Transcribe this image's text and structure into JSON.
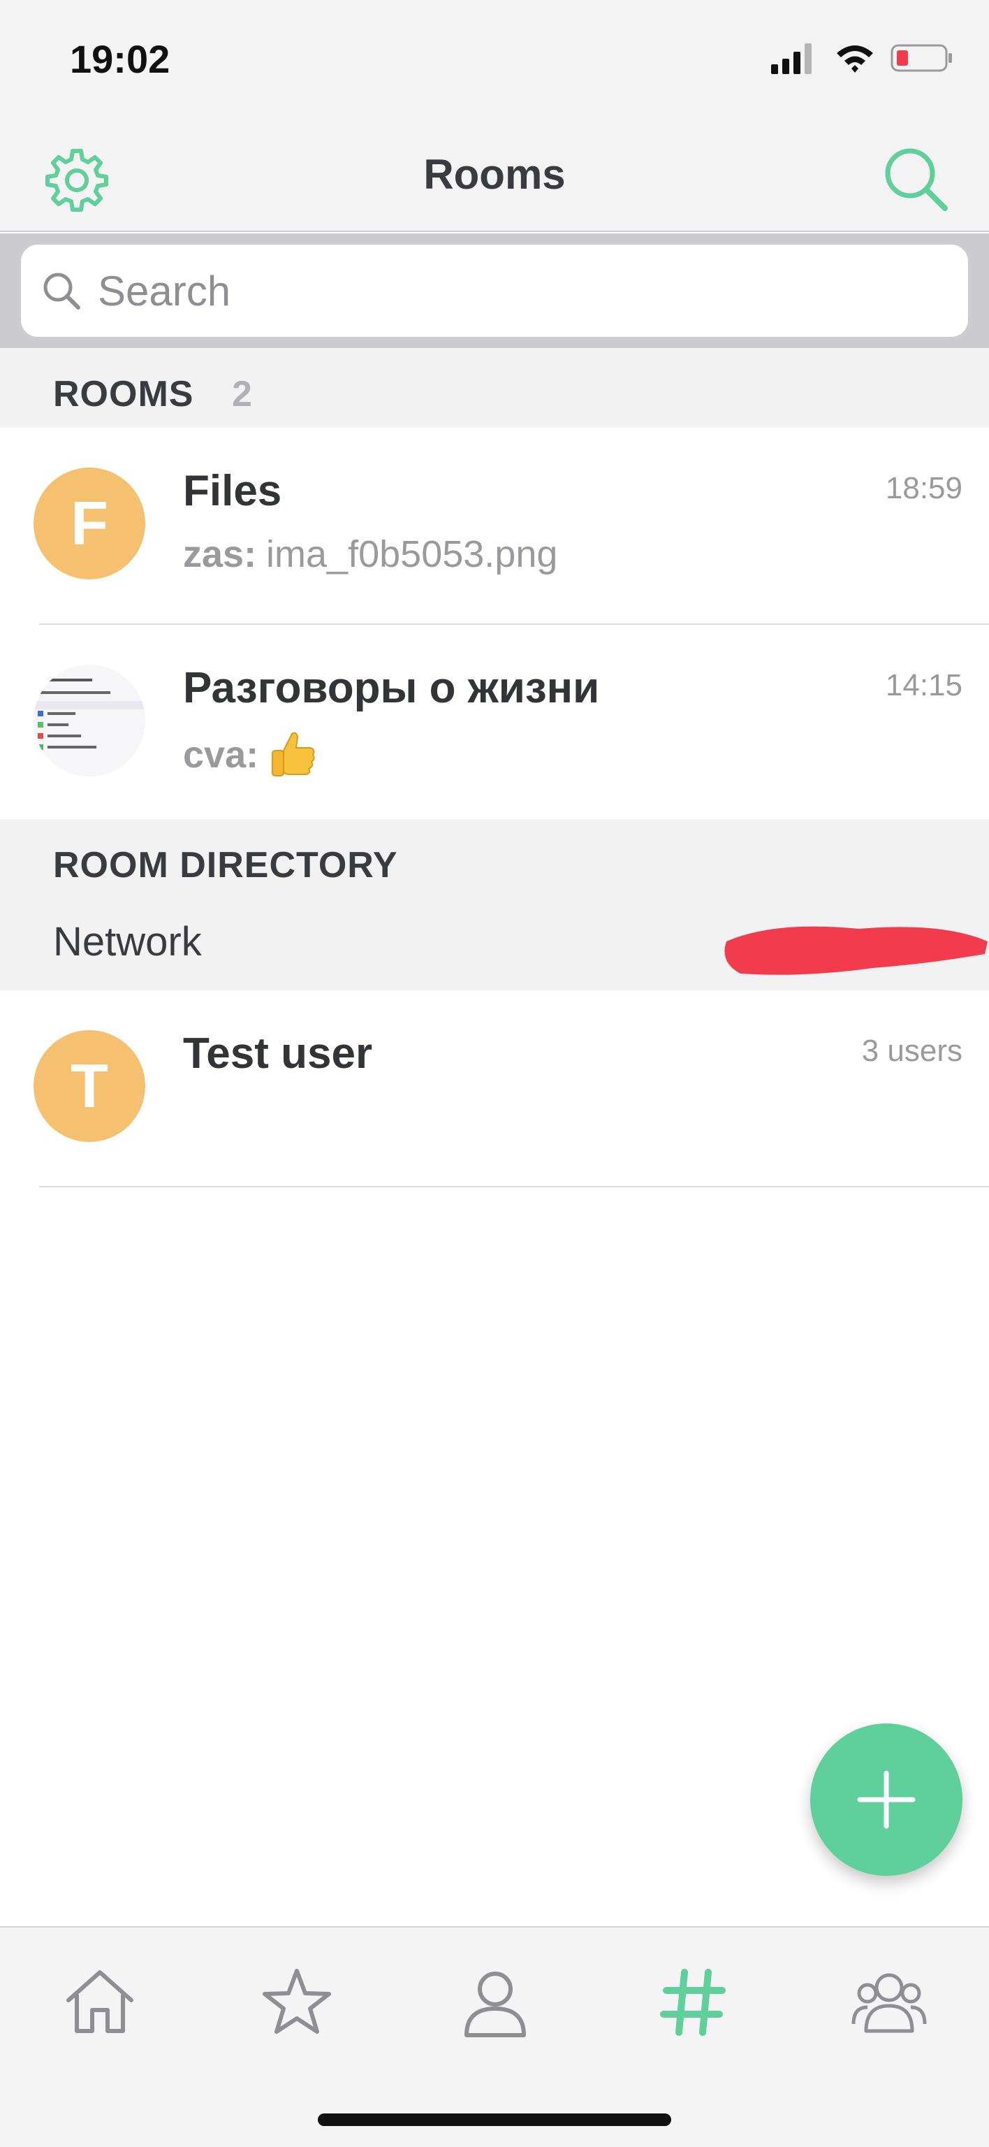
{
  "status_bar": {
    "time": "19:02"
  },
  "nav": {
    "title": "Rooms",
    "settings_icon": "gear-icon",
    "search_icon": "search-icon"
  },
  "search": {
    "placeholder": "Search",
    "value": ""
  },
  "rooms_section": {
    "title": "ROOMS",
    "count": "2",
    "items": [
      {
        "avatar_letter": "F",
        "title": "Files",
        "time": "18:59",
        "sender": "zas:",
        "message": "ima_f0b5053.png"
      },
      {
        "avatar_letter": "",
        "title": "Разговоры о жизни",
        "time": "14:15",
        "sender": "cva:",
        "message": "",
        "message_emoji": "thumbs-up-emoji"
      }
    ]
  },
  "directory_section": {
    "title": "ROOM DIRECTORY",
    "network_label": "Network",
    "items": [
      {
        "avatar_letter": "T",
        "title": "Test user",
        "meta": "3 users"
      }
    ]
  },
  "colors": {
    "accent": "#5fcf9b",
    "avatar": "#f5c171",
    "header_bg": "#f3f3f3",
    "redaction": "#f23b4c"
  },
  "tabs": [
    {
      "icon": "home-icon",
      "active": false
    },
    {
      "icon": "star-icon",
      "active": false
    },
    {
      "icon": "person-icon",
      "active": false
    },
    {
      "icon": "hashtag-icon",
      "active": true
    },
    {
      "icon": "people-icon",
      "active": false
    }
  ]
}
